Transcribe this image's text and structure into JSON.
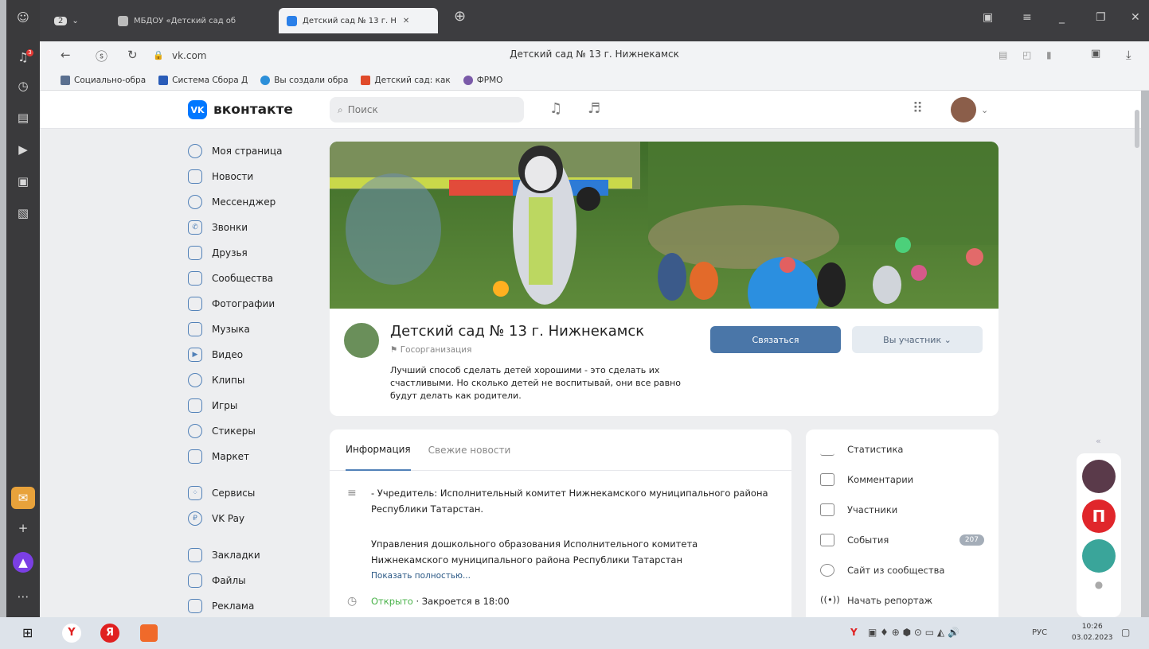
{
  "browser": {
    "tabs": [
      {
        "label": "МБДОУ «Детский сад об",
        "icon": "page-icon",
        "active": false
      },
      {
        "label": "Детский сад № 13 г. Н",
        "icon": "vk-icon",
        "active": true
      }
    ],
    "tab_count": "2",
    "address": "vk.com",
    "page_title": "Детский сад № 13 г. Нижнекамск",
    "bookmarks": [
      {
        "label": "Социально-обра",
        "color": "#5a6f8f"
      },
      {
        "label": "Система Сбора Д",
        "color": "#2a5cb8"
      },
      {
        "label": "Вы создали обра",
        "color": "#2c8fd9"
      },
      {
        "label": "Детский сад: как",
        "color": "#e04a2a"
      },
      {
        "label": "ФРМО",
        "color": "#7a5aa8"
      }
    ],
    "rail_badge": "3"
  },
  "vk": {
    "logo_text": "вконтакте",
    "logo_mark": "VK",
    "search_placeholder": "Поиск",
    "menu": [
      {
        "label": "Моя страница",
        "icon": "user-icon"
      },
      {
        "label": "Новости",
        "icon": "news-icon"
      },
      {
        "label": "Мессенджер",
        "icon": "chat-icon"
      },
      {
        "label": "Звонки",
        "icon": "phone-icon"
      },
      {
        "label": "Друзья",
        "icon": "friends-icon"
      },
      {
        "label": "Сообщества",
        "icon": "communities-icon"
      },
      {
        "label": "Фотографии",
        "icon": "photo-icon"
      },
      {
        "label": "Музыка",
        "icon": "music-icon"
      },
      {
        "label": "Видео",
        "icon": "video-icon"
      },
      {
        "label": "Клипы",
        "icon": "clips-icon"
      },
      {
        "label": "Игры",
        "icon": "games-icon"
      },
      {
        "label": "Стикеры",
        "icon": "stickers-icon"
      },
      {
        "label": "Маркет",
        "icon": "market-icon"
      }
    ],
    "menu2": [
      {
        "label": "Сервисы",
        "icon": "services-icon"
      },
      {
        "label": "VK Pay",
        "icon": "vkpay-icon"
      }
    ],
    "menu3": [
      {
        "label": "Закладки",
        "icon": "bookmark-icon"
      },
      {
        "label": "Файлы",
        "icon": "files-icon"
      },
      {
        "label": "Реклама",
        "icon": "ads-icon"
      }
    ]
  },
  "group": {
    "name": "Детский сад № 13 г. Нижнекамск",
    "type": "Госорганизация",
    "description": "Лучший способ сделать детей хорошими - это сделать их счастливыми. Но сколько детей не воспитывай, они все равно будут делать как родители.",
    "contact_button": "Связаться",
    "member_button": "Вы участник"
  },
  "info": {
    "tabs": [
      "Информация",
      "Свежие новости"
    ],
    "founder": "- Учредитель: Исполнительный комитет Нижнекамского муниципального района Республики Татарстан.",
    "department": "Управления дошкольного образования Исполнительного комитета Нижнекамского муниципального района Республики Татарстан",
    "show_more": "Показать полностью...",
    "open_status": "Открыто",
    "close_time": "· Закроется в 18:00"
  },
  "side_menu": [
    {
      "label": "Статистика",
      "icon": "stats-icon"
    },
    {
      "label": "Комментарии",
      "icon": "comments-icon"
    },
    {
      "label": "Участники",
      "icon": "members-icon"
    },
    {
      "label": "События",
      "icon": "events-icon",
      "count": "207"
    },
    {
      "label": "Сайт из сообщества",
      "icon": "site-icon"
    },
    {
      "label": "Начать репортаж",
      "icon": "broadcast-icon"
    }
  ],
  "taskbar": {
    "lang": "РУС",
    "time": "10:26",
    "date": "03.02.2023"
  }
}
